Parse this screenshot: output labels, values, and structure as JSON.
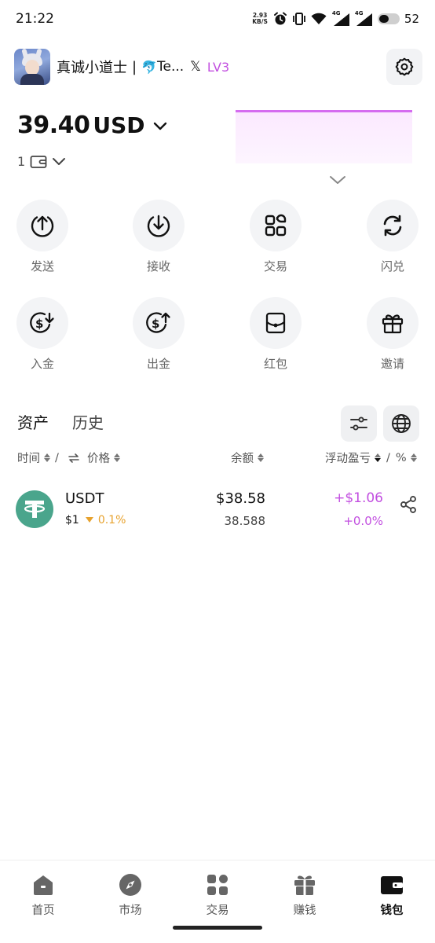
{
  "status_bar": {
    "time": "21:22",
    "net_speed_value": "2.93",
    "net_speed_unit": "KB/S",
    "signal_1_tag": "4G",
    "signal_2_tag": "4G",
    "battery": "52",
    "battery_level_percent": 52
  },
  "header": {
    "account_name": "真诚小道士",
    "divider": "|",
    "dolphin_emoji": "🐬",
    "twitter_name": "Te...",
    "x_logo": "𝕏",
    "level": "LV3"
  },
  "balance": {
    "value": "39.40",
    "currency": "USD",
    "wallet_count": "1"
  },
  "colors": {
    "accent_purple": "#c24fe0",
    "usdt_green": "#4aa58c",
    "change_orange": "#e7a22e"
  },
  "actions": [
    {
      "label": "发送",
      "icon": "send-up-arrow-icon"
    },
    {
      "label": "接收",
      "icon": "receive-down-arrow-icon"
    },
    {
      "label": "交易",
      "icon": "trade-grid-icon"
    },
    {
      "label": "闪兑",
      "icon": "swap-cycle-icon"
    },
    {
      "label": "入金",
      "icon": "deposit-dollar-icon"
    },
    {
      "label": "出金",
      "icon": "withdraw-dollar-icon"
    },
    {
      "label": "红包",
      "icon": "red-packet-icon"
    },
    {
      "label": "邀请",
      "icon": "gift-icon"
    }
  ],
  "tabs": {
    "assets": "资产",
    "history": "历史"
  },
  "columns": {
    "time": "时间",
    "slash": "/",
    "price": "价格",
    "balance": "余额",
    "pnl": "浮动盈亏",
    "pct_slash": "/",
    "pct": "%"
  },
  "assets": [
    {
      "symbol": "USDT",
      "price": "$1",
      "change": "0.1%",
      "change_direction": "down",
      "value": "$38.58",
      "amount": "38.588",
      "pnl": "+$1.06",
      "pnl_pct": "+0.0%"
    }
  ],
  "bottom_nav": [
    {
      "label": "首页",
      "icon": "home-icon"
    },
    {
      "label": "市场",
      "icon": "compass-icon"
    },
    {
      "label": "交易",
      "icon": "trade-icon"
    },
    {
      "label": "赚钱",
      "icon": "gift-box-icon"
    },
    {
      "label": "钱包",
      "icon": "wallet-icon",
      "active": true
    }
  ]
}
